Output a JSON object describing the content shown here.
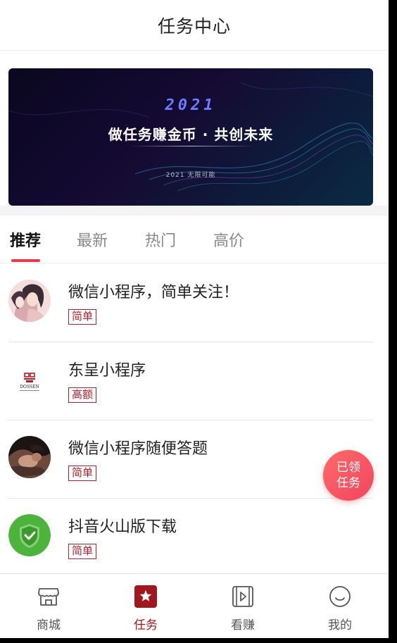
{
  "header": {
    "title": "任务中心"
  },
  "banner": {
    "year": "2021",
    "headline": "做任务赚金币 · 共创未来",
    "subtitle": "2021 无限可能"
  },
  "tabs": [
    {
      "label": "推荐",
      "active": true
    },
    {
      "label": "最新",
      "active": false
    },
    {
      "label": "热门",
      "active": false
    },
    {
      "label": "高价",
      "active": false
    }
  ],
  "tasks": [
    {
      "title": "微信小程序，简单关注！",
      "tag": "简单",
      "icon": "illustrated-couple-avatar"
    },
    {
      "title": "东呈小程序",
      "tag": "高额",
      "icon": "dossen-logo",
      "logo_text": "DOSSEN"
    },
    {
      "title": "微信小程序随便答题",
      "tag": "简单",
      "icon": "portrait-avatar"
    },
    {
      "title": "抖音火山版下载",
      "tag": "简单",
      "icon": "green-shield-icon"
    }
  ],
  "fab": {
    "line1": "已领",
    "line2": "任务"
  },
  "tabbar": [
    {
      "label": "商城",
      "icon": "store-icon",
      "active": false
    },
    {
      "label": "任务",
      "icon": "star-square-icon",
      "active": true
    },
    {
      "label": "看赚",
      "icon": "video-play-icon",
      "active": false
    },
    {
      "label": "我的",
      "icon": "smile-icon",
      "active": false
    }
  ],
  "colors": {
    "accent": "#e8394a",
    "tag_red": "#b8202b",
    "active_tab_red": "#a1171e",
    "fab": "#f2455e"
  }
}
